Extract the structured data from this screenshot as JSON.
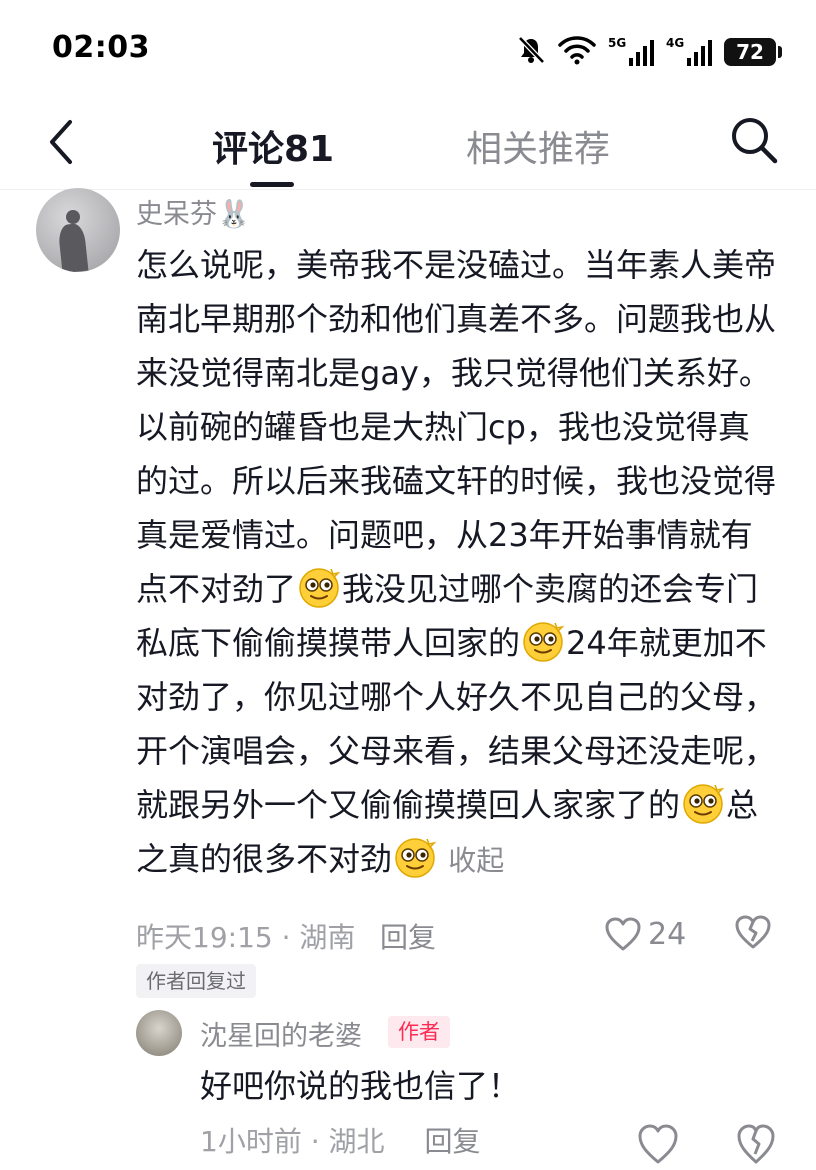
{
  "status_bar": {
    "time": "02:03",
    "signal_5g": "5G",
    "signal_4g": "4G",
    "battery": "72",
    "icons": [
      "mute-icon",
      "wifi-icon",
      "signal-5g-icon",
      "signal-4g-icon",
      "battery-icon"
    ]
  },
  "header": {
    "tab_comments": "评论81",
    "tab_related": "相关推荐",
    "icons": [
      "back-icon",
      "search-icon"
    ]
  },
  "comment": {
    "username": "史呆芬🐰",
    "text": {
      "part1": "怎么说呢，美帝我不是没磕过。当年素人美帝南北早期那个劲和他们真差不多。问题我也从来没觉得南北是gay，我只觉得他们关系好。以前碗的罐昏也是大热门cp，我也没觉得真的过。所以后来我磕文轩的时候，我也没觉得真是爱情过。问题吧，从23年开始事情就有点不对劲了",
      "part2": "我没见过哪个卖腐的还会专门私底下偷偷摸摸带人回家的",
      "part3": "24年就更加不对劲了，你见过哪个人好久不见自己的父母，开个演唱会，父母来看，结果父母还没走呢，就跟另外一个又偷偷摸摸回人家家了的",
      "part4": "总之真的很多不对劲",
      "emoji_name": "dizzy-face-emoji"
    },
    "collapse_label": "收起",
    "timestamp_location": "昨天19:15 · 湖南",
    "reply_label": "回复",
    "like_count": "24",
    "author_replied_tag": "作者回复过"
  },
  "reply": {
    "username": "沈星回的老婆",
    "author_badge": "作者",
    "text": "好吧你说的我也信了！",
    "timestamp_location": "1小时前 · 湖北",
    "reply_label": "回复"
  },
  "colors": {
    "text_primary": "#161823",
    "text_secondary": "#8a8b91",
    "accent_red": "#fe2c55",
    "emoji_yellow": "#ffcf3a"
  }
}
